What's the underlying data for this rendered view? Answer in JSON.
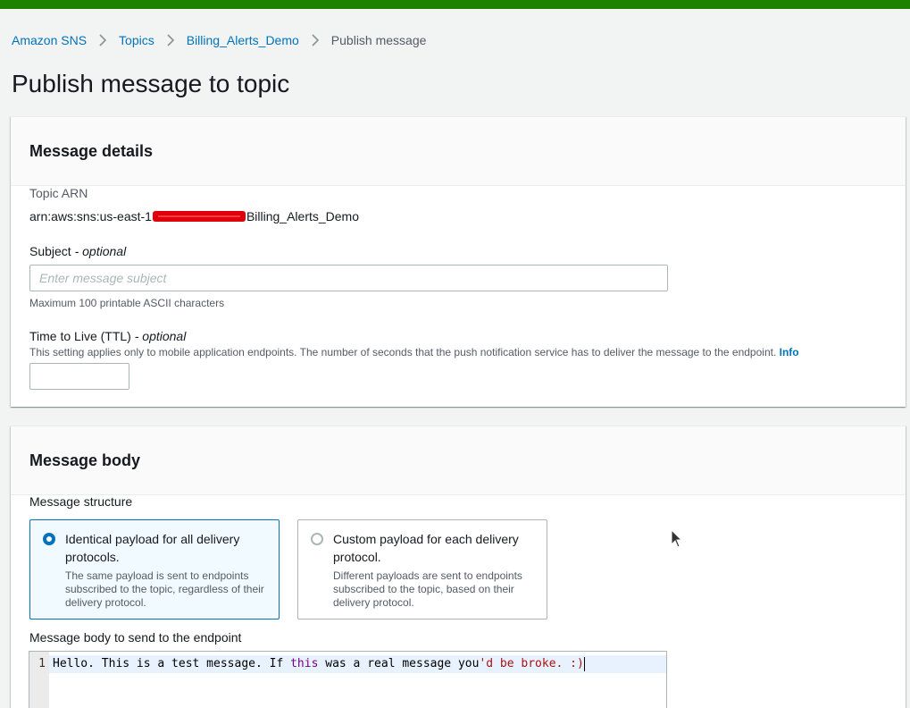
{
  "breadcrumb": {
    "items": [
      "Amazon SNS",
      "Topics",
      "Billing_Alerts_Demo"
    ],
    "current": "Publish message"
  },
  "page": {
    "title": "Publish message to topic"
  },
  "message_details": {
    "heading": "Message details",
    "topic_arn_label": "Topic ARN",
    "topic_arn_prefix": "arn:aws:sns:us-east-1",
    "topic_arn_suffix": "Billing_Alerts_Demo",
    "subject_label": "Subject",
    "subject_optional": "- optional",
    "subject_placeholder": "Enter message subject",
    "subject_value": "",
    "subject_hint": "Maximum 100 printable ASCII characters",
    "ttl_label": "Time to Live (TTL)",
    "ttl_optional": "- optional",
    "ttl_desc": "This setting applies only to mobile application endpoints. The number of seconds that the push notification service has to deliver the message to the endpoint.",
    "ttl_info": "Info",
    "ttl_value": ""
  },
  "message_body": {
    "heading": "Message body",
    "structure_label": "Message structure",
    "options": [
      {
        "title": "Identical payload for all delivery protocols.",
        "desc": "The same payload is sent to endpoints subscribed to the topic, regardless of their delivery protocol.",
        "selected": true
      },
      {
        "title": "Custom payload for each delivery protocol.",
        "desc": "Different payloads are sent to endpoints subscribed to the topic, based on their delivery protocol.",
        "selected": false
      }
    ],
    "body_label": "Message body to send to the endpoint",
    "editor": {
      "line_number": "1",
      "segment_1": "Hello. This is a test message. If ",
      "segment_2": "this",
      "segment_3": " was a real message you",
      "segment_4": "'d be broke. :)"
    }
  },
  "colors": {
    "topbar": "#1d8102",
    "link": "#0073bb",
    "selected_border": "#0073bb",
    "redaction": "#e0000b"
  }
}
